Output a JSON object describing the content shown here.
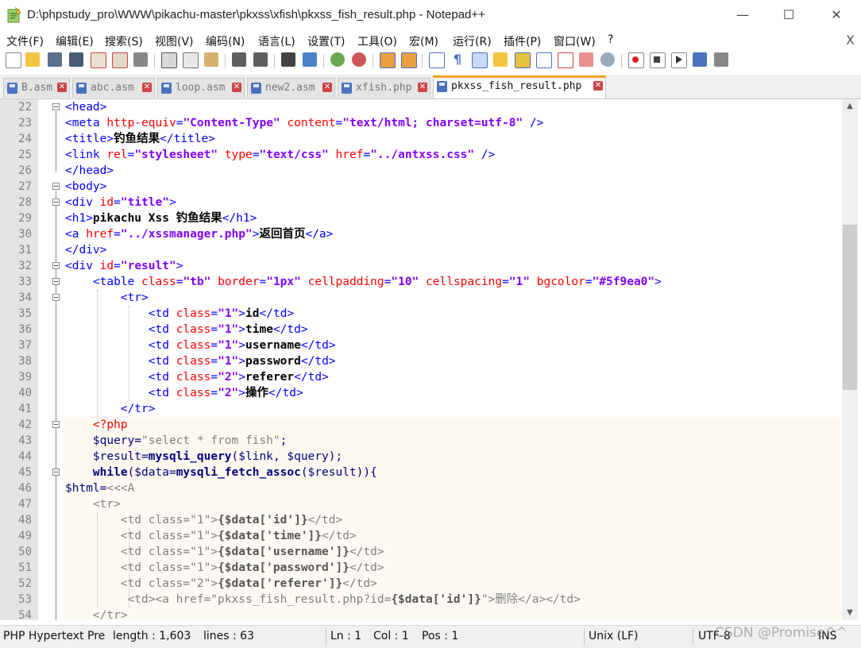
{
  "window": {
    "title": "D:\\phpstudy_pro\\WWW\\pikachu-master\\pkxss\\xfish\\pkxss_fish_result.php - Notepad++",
    "minimize": "—",
    "maximize": "☐",
    "close": "✕"
  },
  "menu": {
    "items": [
      "文件(F)",
      "编辑(E)",
      "搜索(S)",
      "视图(V)",
      "编码(N)",
      "语言(L)",
      "设置(T)",
      "工具(O)",
      "宏(M)",
      "运行(R)",
      "插件(P)",
      "窗口(W)",
      "?"
    ],
    "close": "X"
  },
  "tabs": [
    {
      "label": "B.asm",
      "active": false
    },
    {
      "label": "abc.asm",
      "active": false
    },
    {
      "label": "loop.asm",
      "active": false
    },
    {
      "label": "new2.asm",
      "active": false
    },
    {
      "label": "xfish.php",
      "active": false
    },
    {
      "label": "pkxss_fish_result.php",
      "active": true
    }
  ],
  "editor": {
    "lines": [
      22,
      23,
      24,
      25,
      26,
      27,
      28,
      29,
      30,
      31,
      32,
      33,
      34,
      35,
      36,
      37,
      38,
      39,
      40,
      41,
      42,
      43,
      44,
      45,
      46,
      47,
      48,
      49,
      50,
      51,
      52,
      53,
      54
    ]
  },
  "status": {
    "language": "PHP Hypertext Pre",
    "length": "length : 1,603",
    "lines": "lines : 63",
    "ln": "Ln : 1",
    "col": "Col : 1",
    "pos": "Pos : 1",
    "eol": "Unix (LF)",
    "encoding": "UTF-8",
    "mode": "INS"
  },
  "watermark": "CSDN @Promise^^"
}
